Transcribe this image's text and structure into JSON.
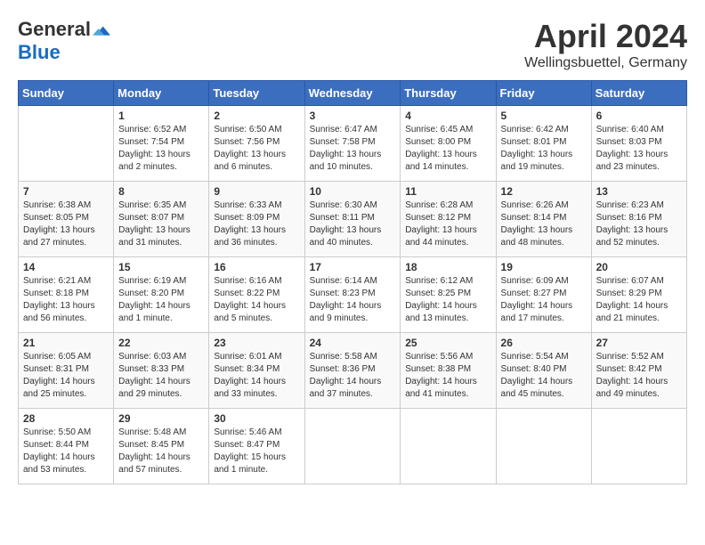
{
  "header": {
    "logo_general": "General",
    "logo_blue": "Blue",
    "title": "April 2024",
    "location": "Wellingsbuettel, Germany"
  },
  "weekdays": [
    "Sunday",
    "Monday",
    "Tuesday",
    "Wednesday",
    "Thursday",
    "Friday",
    "Saturday"
  ],
  "weeks": [
    [
      {
        "day": "",
        "sunrise": "",
        "sunset": "",
        "daylight": ""
      },
      {
        "day": "1",
        "sunrise": "Sunrise: 6:52 AM",
        "sunset": "Sunset: 7:54 PM",
        "daylight": "Daylight: 13 hours and 2 minutes."
      },
      {
        "day": "2",
        "sunrise": "Sunrise: 6:50 AM",
        "sunset": "Sunset: 7:56 PM",
        "daylight": "Daylight: 13 hours and 6 minutes."
      },
      {
        "day": "3",
        "sunrise": "Sunrise: 6:47 AM",
        "sunset": "Sunset: 7:58 PM",
        "daylight": "Daylight: 13 hours and 10 minutes."
      },
      {
        "day": "4",
        "sunrise": "Sunrise: 6:45 AM",
        "sunset": "Sunset: 8:00 PM",
        "daylight": "Daylight: 13 hours and 14 minutes."
      },
      {
        "day": "5",
        "sunrise": "Sunrise: 6:42 AM",
        "sunset": "Sunset: 8:01 PM",
        "daylight": "Daylight: 13 hours and 19 minutes."
      },
      {
        "day": "6",
        "sunrise": "Sunrise: 6:40 AM",
        "sunset": "Sunset: 8:03 PM",
        "daylight": "Daylight: 13 hours and 23 minutes."
      }
    ],
    [
      {
        "day": "7",
        "sunrise": "Sunrise: 6:38 AM",
        "sunset": "Sunset: 8:05 PM",
        "daylight": "Daylight: 13 hours and 27 minutes."
      },
      {
        "day": "8",
        "sunrise": "Sunrise: 6:35 AM",
        "sunset": "Sunset: 8:07 PM",
        "daylight": "Daylight: 13 hours and 31 minutes."
      },
      {
        "day": "9",
        "sunrise": "Sunrise: 6:33 AM",
        "sunset": "Sunset: 8:09 PM",
        "daylight": "Daylight: 13 hours and 36 minutes."
      },
      {
        "day": "10",
        "sunrise": "Sunrise: 6:30 AM",
        "sunset": "Sunset: 8:11 PM",
        "daylight": "Daylight: 13 hours and 40 minutes."
      },
      {
        "day": "11",
        "sunrise": "Sunrise: 6:28 AM",
        "sunset": "Sunset: 8:12 PM",
        "daylight": "Daylight: 13 hours and 44 minutes."
      },
      {
        "day": "12",
        "sunrise": "Sunrise: 6:26 AM",
        "sunset": "Sunset: 8:14 PM",
        "daylight": "Daylight: 13 hours and 48 minutes."
      },
      {
        "day": "13",
        "sunrise": "Sunrise: 6:23 AM",
        "sunset": "Sunset: 8:16 PM",
        "daylight": "Daylight: 13 hours and 52 minutes."
      }
    ],
    [
      {
        "day": "14",
        "sunrise": "Sunrise: 6:21 AM",
        "sunset": "Sunset: 8:18 PM",
        "daylight": "Daylight: 13 hours and 56 minutes."
      },
      {
        "day": "15",
        "sunrise": "Sunrise: 6:19 AM",
        "sunset": "Sunset: 8:20 PM",
        "daylight": "Daylight: 14 hours and 1 minute."
      },
      {
        "day": "16",
        "sunrise": "Sunrise: 6:16 AM",
        "sunset": "Sunset: 8:22 PM",
        "daylight": "Daylight: 14 hours and 5 minutes."
      },
      {
        "day": "17",
        "sunrise": "Sunrise: 6:14 AM",
        "sunset": "Sunset: 8:23 PM",
        "daylight": "Daylight: 14 hours and 9 minutes."
      },
      {
        "day": "18",
        "sunrise": "Sunrise: 6:12 AM",
        "sunset": "Sunset: 8:25 PM",
        "daylight": "Daylight: 14 hours and 13 minutes."
      },
      {
        "day": "19",
        "sunrise": "Sunrise: 6:09 AM",
        "sunset": "Sunset: 8:27 PM",
        "daylight": "Daylight: 14 hours and 17 minutes."
      },
      {
        "day": "20",
        "sunrise": "Sunrise: 6:07 AM",
        "sunset": "Sunset: 8:29 PM",
        "daylight": "Daylight: 14 hours and 21 minutes."
      }
    ],
    [
      {
        "day": "21",
        "sunrise": "Sunrise: 6:05 AM",
        "sunset": "Sunset: 8:31 PM",
        "daylight": "Daylight: 14 hours and 25 minutes."
      },
      {
        "day": "22",
        "sunrise": "Sunrise: 6:03 AM",
        "sunset": "Sunset: 8:33 PM",
        "daylight": "Daylight: 14 hours and 29 minutes."
      },
      {
        "day": "23",
        "sunrise": "Sunrise: 6:01 AM",
        "sunset": "Sunset: 8:34 PM",
        "daylight": "Daylight: 14 hours and 33 minutes."
      },
      {
        "day": "24",
        "sunrise": "Sunrise: 5:58 AM",
        "sunset": "Sunset: 8:36 PM",
        "daylight": "Daylight: 14 hours and 37 minutes."
      },
      {
        "day": "25",
        "sunrise": "Sunrise: 5:56 AM",
        "sunset": "Sunset: 8:38 PM",
        "daylight": "Daylight: 14 hours and 41 minutes."
      },
      {
        "day": "26",
        "sunrise": "Sunrise: 5:54 AM",
        "sunset": "Sunset: 8:40 PM",
        "daylight": "Daylight: 14 hours and 45 minutes."
      },
      {
        "day": "27",
        "sunrise": "Sunrise: 5:52 AM",
        "sunset": "Sunset: 8:42 PM",
        "daylight": "Daylight: 14 hours and 49 minutes."
      }
    ],
    [
      {
        "day": "28",
        "sunrise": "Sunrise: 5:50 AM",
        "sunset": "Sunset: 8:44 PM",
        "daylight": "Daylight: 14 hours and 53 minutes."
      },
      {
        "day": "29",
        "sunrise": "Sunrise: 5:48 AM",
        "sunset": "Sunset: 8:45 PM",
        "daylight": "Daylight: 14 hours and 57 minutes."
      },
      {
        "day": "30",
        "sunrise": "Sunrise: 5:46 AM",
        "sunset": "Sunset: 8:47 PM",
        "daylight": "Daylight: 15 hours and 1 minute."
      },
      {
        "day": "",
        "sunrise": "",
        "sunset": "",
        "daylight": ""
      },
      {
        "day": "",
        "sunrise": "",
        "sunset": "",
        "daylight": ""
      },
      {
        "day": "",
        "sunrise": "",
        "sunset": "",
        "daylight": ""
      },
      {
        "day": "",
        "sunrise": "",
        "sunset": "",
        "daylight": ""
      }
    ]
  ]
}
